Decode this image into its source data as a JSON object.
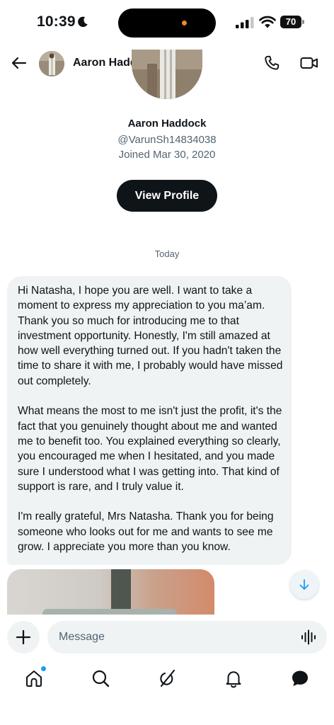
{
  "status_bar": {
    "time": "10:39",
    "battery_level": "70",
    "icons": [
      "moon-icon",
      "signal-icon",
      "wifi-icon",
      "battery-icon"
    ]
  },
  "header": {
    "contact_name": "Aaron Haddock",
    "icons": [
      "back-arrow-icon",
      "phone-icon",
      "video-camera-icon"
    ]
  },
  "profile": {
    "name": "Aaron Haddock",
    "handle": "@VarunSh14834038",
    "joined": "Joined Mar 30, 2020",
    "view_profile_label": "View Profile"
  },
  "conversation": {
    "date_label": "Today",
    "messages": [
      {
        "paragraphs": [
          "Hi Natasha, I hope you are well. I want to take a moment to express my appreciation to you ma’am. Thank you so much for introducing me to that investment opportunity. Honestly, I'm still amazed at how well everything turned out. If you hadn't taken the time to share it with me, I probably would have missed out completely.",
          "What means the most to me isn't just the profit, it's the fact that you genuinely thought about me and wanted me to benefit too. You explained everything so clearly, you encouraged me when I hesitated, and you made sure I understood what I was getting into. That kind of support is rare, and I truly value it.",
          "I'm really grateful, Mrs Natasha. Thank you for being someone who looks out for me and wants to see me grow. I appreciate you more than you know."
        ]
      }
    ]
  },
  "composer": {
    "placeholder": "Message",
    "value": ""
  },
  "bottom_nav": {
    "items": [
      "home-icon",
      "search-icon",
      "grok-icon",
      "notifications-bell-icon",
      "messages-icon"
    ],
    "active": "messages-icon",
    "home_has_badge": true
  },
  "colors": {
    "accent": "#1d9bf0",
    "bubble_bg": "#eff3f4",
    "primary_text": "#0f1419",
    "secondary_text": "#536471",
    "button_dark": "#0f1419"
  }
}
